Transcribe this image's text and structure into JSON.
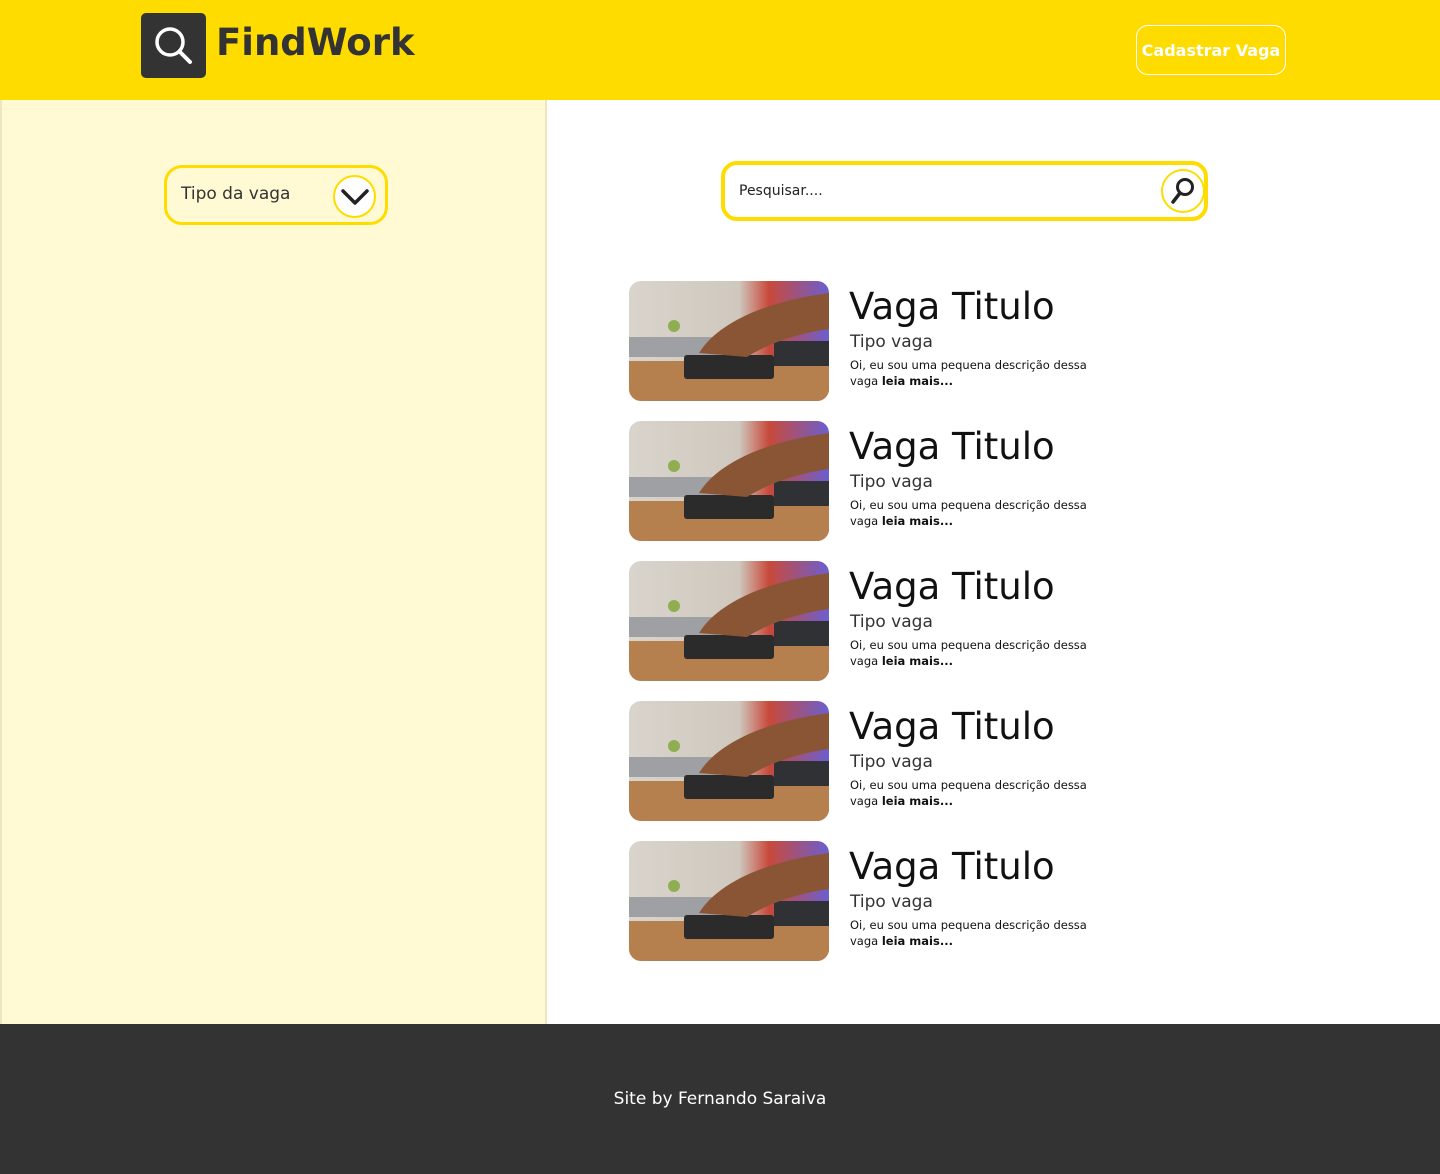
{
  "header": {
    "brand": "FindWork",
    "logo_icon": "search-icon",
    "cta_label": "Cadastrar Vaga"
  },
  "sidebar": {
    "filter_label": "Tipo da vaga",
    "filter_icon": "chevron-down-icon"
  },
  "search": {
    "placeholder": "Pesquisar....",
    "icon": "magnifier-icon"
  },
  "jobs": [
    {
      "title": "Vaga Titulo",
      "type": "Tipo vaga",
      "description": "Oi, eu sou uma pequena descrição dessa vaga",
      "more": "leia mais..."
    },
    {
      "title": "Vaga Titulo",
      "type": "Tipo vaga",
      "description": "Oi, eu sou uma pequena descrição dessa vaga",
      "more": "leia mais..."
    },
    {
      "title": "Vaga Titulo",
      "type": "Tipo vaga",
      "description": "Oi, eu sou uma pequena descrição dessa vaga",
      "more": "leia mais..."
    },
    {
      "title": "Vaga Titulo",
      "type": "Tipo vaga",
      "description": "Oi, eu sou uma pequena descrição dessa vaga",
      "more": "leia mais..."
    },
    {
      "title": "Vaga Titulo",
      "type": "Tipo vaga",
      "description": "Oi, eu sou uma pequena descrição dessa vaga",
      "more": "leia mais..."
    }
  ],
  "footer": {
    "credit": "Site by Fernando Saraiva"
  },
  "colors": {
    "brand_yellow": "#FFDC00",
    "sidebar_bg": "#FFF9D4",
    "dark": "#333333"
  }
}
